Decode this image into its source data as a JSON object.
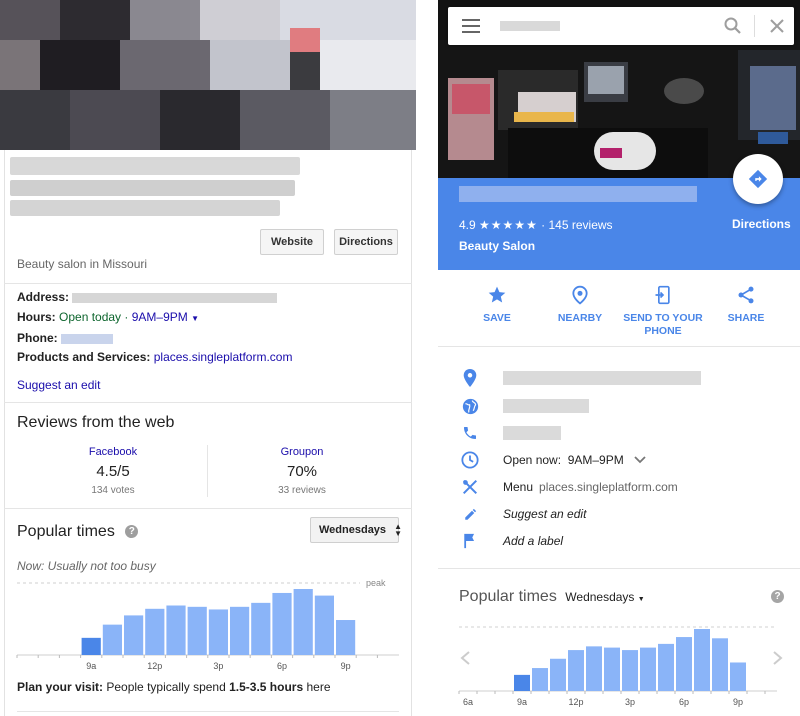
{
  "left": {
    "buttons": {
      "website": "Website",
      "directions": "Directions"
    },
    "category": "Beauty salon in Missouri",
    "address_label": "Address:",
    "hours_label": "Hours:",
    "hours_status": "Open today",
    "hours_sep": " · ",
    "hours_value": "9AM–9PM",
    "phone_label": "Phone:",
    "products_label": "Products and Services:",
    "products_link": "places.singleplatform.com",
    "suggest_edit": "Suggest an edit",
    "reviews_heading": "Reviews from the web",
    "reviews": [
      {
        "source": "Facebook",
        "score": "4.5/5",
        "count": "134 votes"
      },
      {
        "source": "Groupon",
        "score": "70%",
        "count": "33 reviews"
      }
    ],
    "popular_times": "Popular times",
    "help_icon": "?",
    "day_selector": "Wednesdays",
    "now_text": "Now: Usually not too busy",
    "peak_label": "peak",
    "plan_label": "Plan your visit:",
    "plan_text": " People typically spend ",
    "plan_duration": "1.5-3.5 hours",
    "plan_suffix": " here"
  },
  "right": {
    "search_placeholder": "",
    "rating": "4.9",
    "stars": "★★★★★",
    "reviews_count": "· 145 reviews",
    "category": "Beauty Salon",
    "directions": "Directions",
    "actions": [
      {
        "label": "SAVE",
        "icon": "star-icon"
      },
      {
        "label": "NEARBY",
        "icon": "nearby-icon"
      },
      {
        "label": "SEND TO YOUR PHONE",
        "icon": "send-to-phone-icon"
      },
      {
        "label": "SHARE",
        "icon": "share-icon"
      }
    ],
    "hours_text": "Open now:  9AM–9PM",
    "menu_label": "Menu",
    "menu_link": "places.singleplatform.com",
    "suggest_edit": "Suggest an edit",
    "add_label": "Add a label",
    "popular_times": "Popular times",
    "day_selector": "Wednesdays"
  },
  "colors": {
    "accent_blue": "#4a86e8",
    "bar_blue": "#8ab4f8",
    "bar_current": "#4a86e8",
    "link": "#1a0dab"
  },
  "chart_data": [
    {
      "type": "bar",
      "title": "Popular times",
      "categories": [
        "6a",
        "7a",
        "8a",
        "9a",
        "10a",
        "11a",
        "12p",
        "1p",
        "2p",
        "3p",
        "4p",
        "5p",
        "6p",
        "7p",
        "8p",
        "9p",
        "10p",
        "11p"
      ],
      "x_ticks": [
        "9a",
        "12p",
        "3p",
        "6p",
        "9p"
      ],
      "values": [
        0,
        0,
        0,
        26,
        46,
        60,
        70,
        75,
        73,
        69,
        73,
        79,
        94,
        100,
        90,
        53,
        0,
        0
      ],
      "current_hour": "9a"
    },
    {
      "type": "bar",
      "title": "Popular times",
      "categories": [
        "6a",
        "7a",
        "8a",
        "9a",
        "10a",
        "11a",
        "12p",
        "1p",
        "2p",
        "3p",
        "4p",
        "5p",
        "6p",
        "7p",
        "8p",
        "9p",
        "10p",
        "11p"
      ],
      "x_ticks": [
        "6a",
        "9a",
        "12p",
        "3p",
        "6p",
        "9p"
      ],
      "values": [
        0,
        0,
        0,
        26,
        37,
        52,
        66,
        72,
        70,
        66,
        70,
        76,
        87,
        100,
        85,
        46,
        0,
        0
      ],
      "current_hour": "9a"
    }
  ]
}
